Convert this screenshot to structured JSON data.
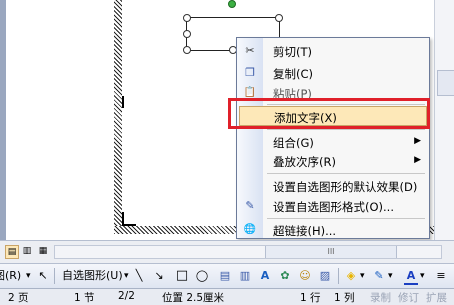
{
  "context_menu": {
    "items": [
      {
        "label": "剪切(T)",
        "icon": "scissors-icon",
        "icon_glyph": "✂"
      },
      {
        "label": "复制(C)",
        "icon": "copy-icon",
        "icon_glyph": "❐"
      },
      {
        "label": "粘贴(P)",
        "icon": "paste-icon",
        "icon_glyph": "📋"
      },
      {
        "label": "添加文字(X)"
      },
      {
        "label": "组合(G)",
        "submenu": "▶"
      },
      {
        "label": "叠放次序(R)",
        "submenu": "▶"
      },
      {
        "label": "设置自选图形的默认效果(D)"
      },
      {
        "label": "设置自选图形格式(O)...",
        "icon": "format-shape-icon",
        "icon_glyph": "✎"
      },
      {
        "label": "超链接(H)...",
        "icon": "hyperlink-icon",
        "icon_glyph": "🌐"
      }
    ],
    "highlight_color": "#fde8b8",
    "annotation_color": "#e0202a"
  },
  "scrollbar": {
    "grip": "III"
  },
  "view_buttons": [
    "▤",
    "▥",
    "▦"
  ],
  "drawing_toolbar": {
    "draw_label": "图(R)",
    "draw_arrow": "▾",
    "select_icon": "↖",
    "autoshapes_label": "自选图形(U)",
    "autoshapes_arrow": "▾",
    "line_icon": "╲",
    "arrow_icon": "↘",
    "rect_icon": "□",
    "oval_icon": "◯",
    "textbox_icon": "▤",
    "textbox_v_icon": "▥",
    "wordart_icon": "A",
    "diagram_icon": "✿",
    "clipart_icon": "☺",
    "picture_icon": "▨",
    "fill_icon": "◈",
    "fill_arrow": "▾",
    "linecolor_icon": "✎",
    "linecolor_arrow": "▾",
    "fontcolor_icon": "A",
    "fontcolor_arrow": "▾",
    "linestyle_icon": "≡"
  },
  "status_bar": {
    "page": "2 页",
    "section": "1 节",
    "page_of": "2/2",
    "position": "位置 2.5厘米",
    "line": "1 行",
    "column": "1 列",
    "rec": "录制",
    "trk": "修订",
    "ext": "扩展"
  }
}
